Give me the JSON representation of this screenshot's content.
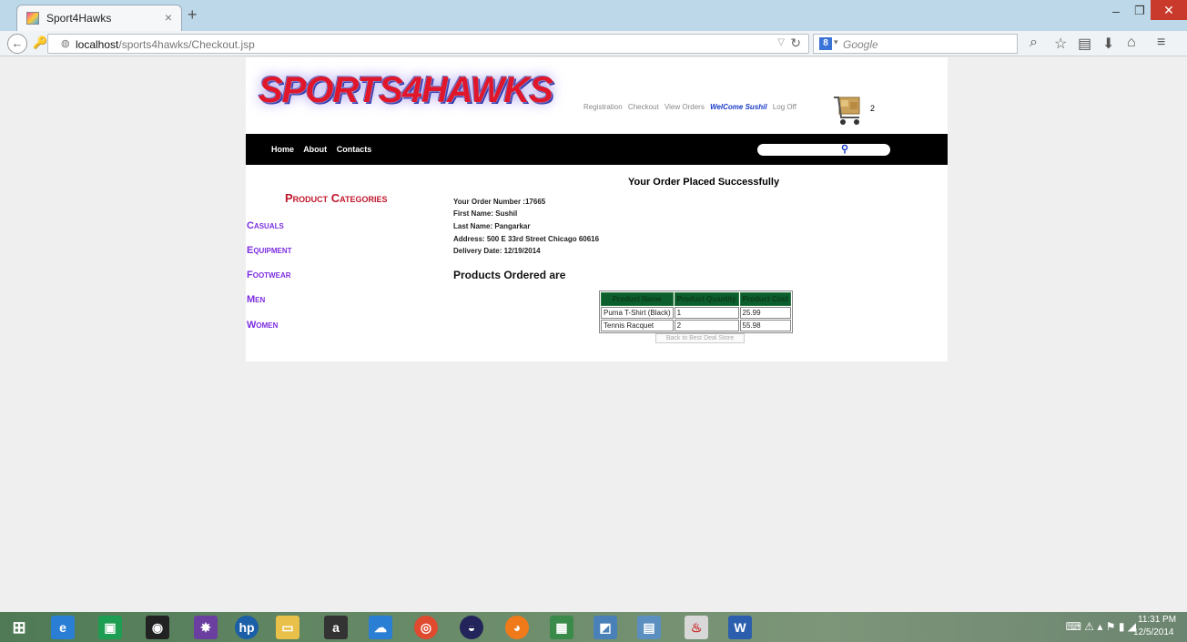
{
  "browser": {
    "tab_title": "Sport4Hawks",
    "url_host": "localhost",
    "url_path": "/sports4hawks/Checkout.jsp",
    "search_placeholder": "Google",
    "search_engine_letter": "8"
  },
  "site": {
    "logo_text": "SPORTS4HAWKS",
    "top_nav": [
      "Registration",
      "Checkout",
      "View Orders"
    ],
    "welcome": "WelCome Sushil",
    "logoff": "Log Off",
    "cart_count": "2",
    "menu": [
      "Home",
      "About",
      "Contacts"
    ]
  },
  "sidebar": {
    "title": "Product Categories",
    "categories": [
      "Casuals",
      "Equipment",
      "Footwear",
      "Men",
      "Women"
    ]
  },
  "order": {
    "confirmation": "Your Order Placed Successfully",
    "order_number": "Your Order Number :17665",
    "first_name": "First Name: Sushil",
    "last_name": "Last Name: Pangarkar",
    "address": "Address: 500 E 33rd Street Chicago 60616",
    "delivery_date": "Delivery Date: 12/19/2014",
    "products_title": "Products Ordered are",
    "table_headers": [
      "Product Name",
      "Product Quantity",
      "Product Cost"
    ],
    "rows": [
      {
        "name": "Puma T-Shirt (Black)",
        "qty": "1",
        "cost": "25.99"
      },
      {
        "name": "Tennis Racquet",
        "qty": "2",
        "cost": "55.98"
      }
    ],
    "back_button": "Back to Best Deal Store"
  },
  "taskbar": {
    "time": "11:31 PM",
    "date": "12/5/2014"
  },
  "colors": {
    "accent_red": "#e0162b",
    "category_purple": "#7b2ee0",
    "table_header_green": "#0c5e2c",
    "welcome_blue": "#1a3bc8"
  }
}
